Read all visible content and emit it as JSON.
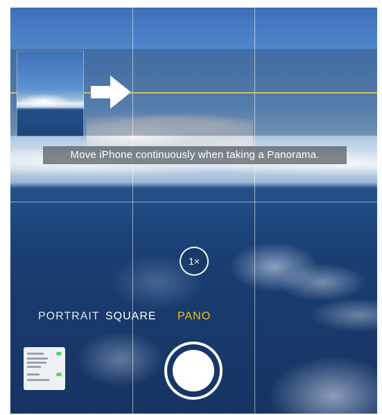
{
  "camera": {
    "hint_text": "Move iPhone continuously when taking a Panorama.",
    "zoom_label": "1×",
    "modes": [
      {
        "label": "PORTRAIT",
        "selected": false
      },
      {
        "label": "SQUARE",
        "selected": false
      },
      {
        "label": "PANO",
        "selected": true
      }
    ],
    "accent_color": "#f1c40f",
    "pano_arrow_icon": "arrow-right-icon"
  }
}
